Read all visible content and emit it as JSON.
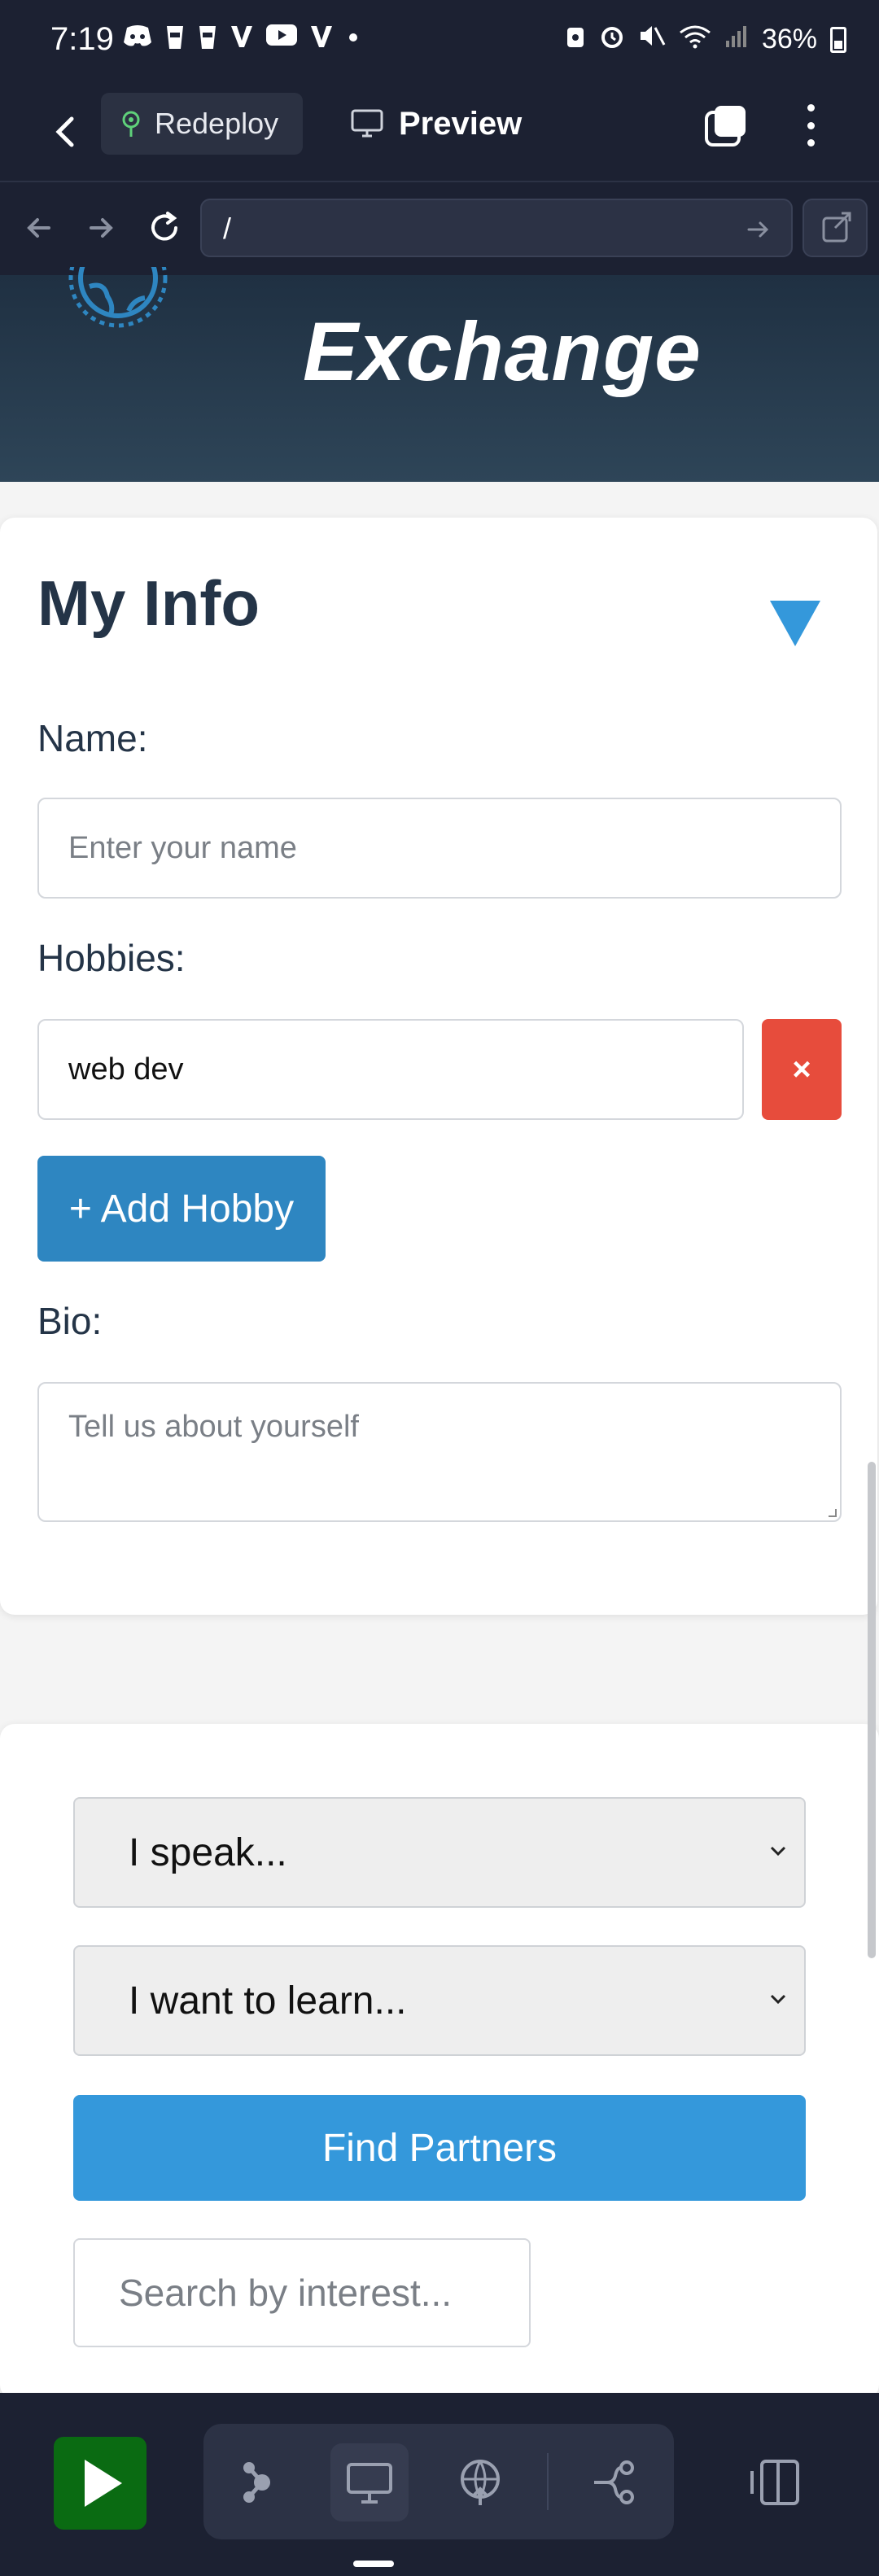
{
  "status_bar": {
    "time": "7:19",
    "battery": "36%",
    "notification_icons": [
      "discord-icon",
      "cup-icon",
      "cup-icon",
      "v-icon",
      "youtube-icon",
      "v-icon",
      "dot-icon"
    ]
  },
  "app_bar": {
    "redeploy_label": "Redeploy",
    "preview_label": "Preview"
  },
  "url_bar": {
    "url": "/"
  },
  "hero": {
    "title": "Exchange"
  },
  "my_info": {
    "heading": "My Info",
    "name_label": "Name:",
    "name_placeholder": "Enter your name",
    "hobbies_label": "Hobbies:",
    "hobbies": [
      "web dev"
    ],
    "remove_label": "×",
    "add_hobby_label": "+ Add Hobby",
    "bio_label": "Bio:",
    "bio_placeholder": "Tell us about yourself"
  },
  "partner_search": {
    "speak_select": "I speak...",
    "learn_select": "I want to learn...",
    "find_button": "Find Partners",
    "search_placeholder": "Search by interest..."
  },
  "colors": {
    "dark_bar": "#1c2132",
    "primary_blue": "#3498db",
    "add_blue": "#2e86c1",
    "remove_red": "#e74c3c",
    "run_green": "#0a6b12",
    "heading": "#243447"
  }
}
